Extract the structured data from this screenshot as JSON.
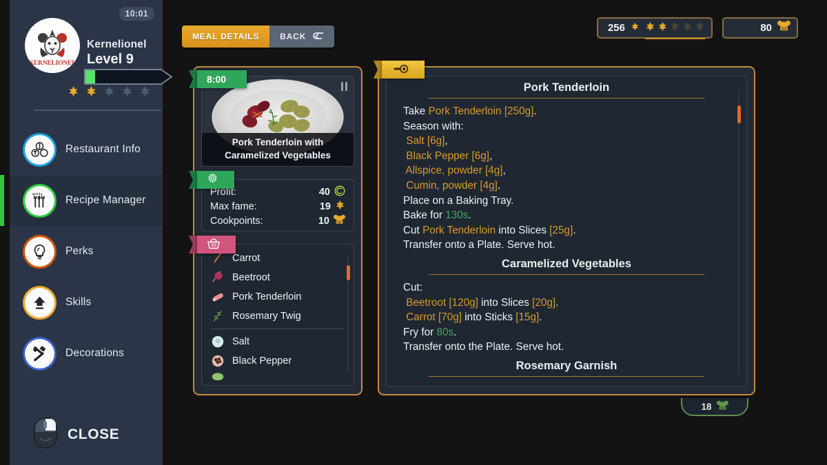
{
  "sidebar": {
    "clock": "10:01",
    "brand_text": "KERNELIONEL",
    "player_name": "Kernelionel",
    "player_level": "Level 9",
    "stars_total": 5,
    "stars_filled": 2,
    "xp_percent": 12,
    "items": [
      {
        "label": "Restaurant Info",
        "icon": "restaurant-info-icon",
        "active": false,
        "ring": "#1ba1e2"
      },
      {
        "label": "Recipe Manager",
        "icon": "recipe-manager-icon",
        "active": true,
        "ring": "#2ecc40"
      },
      {
        "label": "Perks",
        "icon": "perks-bulb-icon",
        "active": false,
        "ring": "#d35400"
      },
      {
        "label": "Skills",
        "icon": "skills-arrow-icon",
        "active": false,
        "ring": "#e8a92b"
      },
      {
        "label": "Decorations",
        "icon": "decorations-hammer-icon",
        "active": false,
        "ring": "#3a5fc8"
      }
    ],
    "close_label": "CLOSE"
  },
  "topbar": {
    "tab_selected": "MEAL DETAILS",
    "tab_back": "BACK",
    "back_icon": "return-arrow-icon",
    "fame_value": "256",
    "fame_icon": "fame-diamond-icon",
    "fame_stars_total": 5,
    "fame_stars_filled": 2,
    "cookpoints_value": "80",
    "cookpoints_icon": "chef-hat-icon"
  },
  "meal": {
    "timer": "8:00",
    "timer_icon": "timer-ribbon",
    "pause_icon": "pause-icon",
    "title_line1": "Pork Tenderloin with",
    "title_line2": "Caramelized Vegetables",
    "stats_ribbon_icon": "gear-icon",
    "stats": [
      {
        "label": "Profit:",
        "value": "40",
        "icon": "coin-icon"
      },
      {
        "label": "Max fame:",
        "value": "19",
        "icon": "fame-diamond-icon"
      },
      {
        "label": "Cookpoints:",
        "value": "10",
        "icon": "chef-hat-icon"
      }
    ],
    "ingredients_ribbon_icon": "basket-icon",
    "ingredients": [
      {
        "label": "Carrot",
        "icon": "carrot-icon"
      },
      {
        "label": "Beetroot",
        "icon": "beetroot-icon"
      },
      {
        "label": "Pork Tenderloin",
        "icon": "pork-icon"
      },
      {
        "label": "Rosemary Twig",
        "icon": "rosemary-icon"
      }
    ],
    "seasonings": [
      {
        "label": "Salt",
        "icon": "salt-icon"
      },
      {
        "label": "Black Pepper",
        "icon": "pepper-icon"
      }
    ]
  },
  "recipe": {
    "ribbon_icon": "recipe-magnifier-icon",
    "sections": [
      {
        "title": "Pork Tenderloin",
        "lines": [
          [
            {
              "t": "Take ",
              "c": "plain"
            },
            {
              "t": "Pork Tenderloin [250g]",
              "c": "ing"
            },
            {
              "t": ".",
              "c": "plain"
            }
          ],
          [
            {
              "t": "Season with:",
              "c": "plain"
            }
          ],
          [
            {
              "t": " Salt [6g]",
              "c": "ing"
            },
            {
              "t": ",",
              "c": "plain"
            }
          ],
          [
            {
              "t": " Black Pepper [6g]",
              "c": "ing"
            },
            {
              "t": ",",
              "c": "plain"
            }
          ],
          [
            {
              "t": " Allspice, powder [4g]",
              "c": "ing"
            },
            {
              "t": ",",
              "c": "plain"
            }
          ],
          [
            {
              "t": " Cumin, powder [4g]",
              "c": "ing"
            },
            {
              "t": ".",
              "c": "plain"
            }
          ],
          [
            {
              "t": "Place on a Baking Tray.",
              "c": "plain"
            }
          ],
          [
            {
              "t": "Bake for ",
              "c": "plain"
            },
            {
              "t": "130s",
              "c": "time"
            },
            {
              "t": ".",
              "c": "plain"
            }
          ],
          [
            {
              "t": "Cut ",
              "c": "plain"
            },
            {
              "t": "Pork Tenderloin",
              "c": "ing"
            },
            {
              "t": " into Slices ",
              "c": "plain"
            },
            {
              "t": "[25g]",
              "c": "ing"
            },
            {
              "t": ".",
              "c": "plain"
            }
          ],
          [
            {
              "t": "Transfer onto a Plate. Serve hot.",
              "c": "plain"
            }
          ]
        ]
      },
      {
        "title": "Caramelized Vegetables",
        "lines": [
          [
            {
              "t": "Cut:",
              "c": "plain"
            }
          ],
          [
            {
              "t": " Beetroot [120g]",
              "c": "ing"
            },
            {
              "t": " into Slices ",
              "c": "plain"
            },
            {
              "t": "[20g]",
              "c": "ing"
            },
            {
              "t": ".",
              "c": "plain"
            }
          ],
          [
            {
              "t": " Carrot [70g]",
              "c": "ing"
            },
            {
              "t": " into Sticks ",
              "c": "plain"
            },
            {
              "t": "[15g]",
              "c": "ing"
            },
            {
              "t": ".",
              "c": "plain"
            }
          ],
          [
            {
              "t": "Fry for ",
              "c": "plain"
            },
            {
              "t": "80s",
              "c": "time"
            },
            {
              "t": ".",
              "c": "plain"
            }
          ],
          [
            {
              "t": "Transfer onto the Plate. Serve hot.",
              "c": "plain"
            }
          ]
        ]
      },
      {
        "title": "Rosemary Garnish",
        "lines": []
      }
    ]
  },
  "bottom_badge": {
    "value": "18",
    "icon": "chef-hat-icon"
  },
  "colors": {
    "accent_gold": "#d99a2b",
    "accent_green": "#3fa85d",
    "panel_border": "#c08a3e",
    "sidebar_bg": "#2b3547",
    "scroll_thumb": "#e06a2b"
  }
}
